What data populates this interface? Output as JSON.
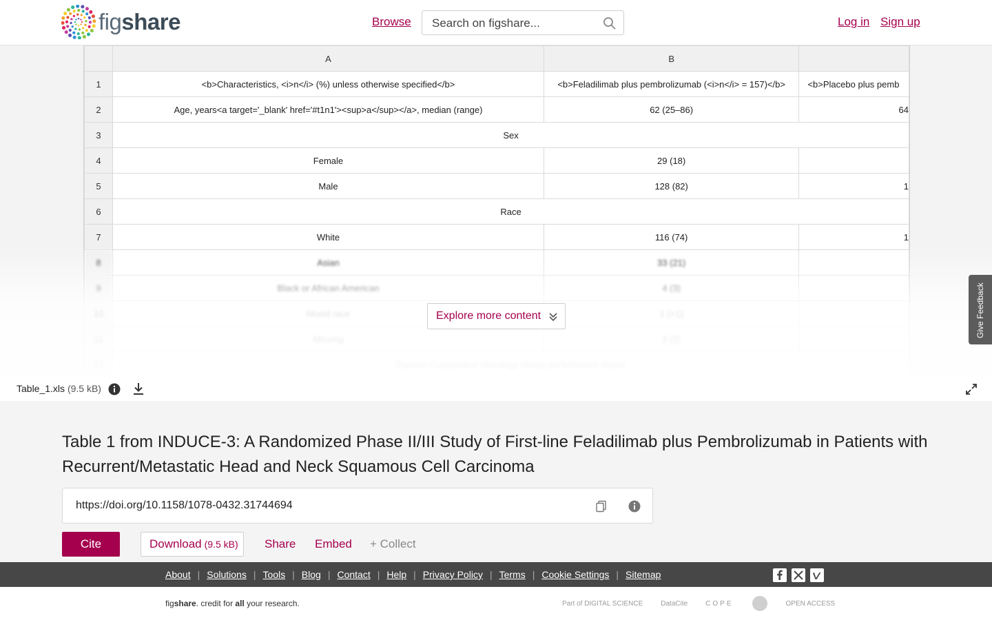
{
  "header": {
    "logo_text_light": "fig",
    "logo_text_bold": "share",
    "browse": "Browse",
    "search_placeholder": "Search on figshare...",
    "login": "Log in",
    "signup": "Sign up"
  },
  "sheet": {
    "columns": [
      "A",
      "B",
      ""
    ],
    "rows": [
      {
        "n": "1",
        "a": "<b>Characteristics, <i>n</i> (%) unless otherwise specified</b>",
        "b": "<b>Feladilimab plus pembrolizumab (<i>n</i> = 157)</b>",
        "c": "<b>Placebo plus pemb"
      },
      {
        "n": "2",
        "a": "Age, years<a target='_blank' href='#t1n1'><sup>a</sup></a>, median (range)",
        "b": "62 (25–86)",
        "c": "64"
      },
      {
        "n": "3",
        "merged": "Sex"
      },
      {
        "n": "4",
        "a": "Female",
        "b": "29 (18)",
        "c": ""
      },
      {
        "n": "5",
        "a": "Male",
        "b": "128 (82)",
        "c": "1"
      },
      {
        "n": "6",
        "merged": "Race"
      },
      {
        "n": "7",
        "a": "White",
        "b": "116 (74)",
        "c": "1"
      },
      {
        "n": "8",
        "a": "Asian",
        "b": "33 (21)",
        "c": ""
      },
      {
        "n": "9",
        "a": "Black or African American",
        "b": "4 (3)",
        "c": ""
      },
      {
        "n": "10",
        "a": "Mixed race",
        "b": "1 (<1)",
        "c": ""
      },
      {
        "n": "11",
        "a": "Missing",
        "b": "3 (2)",
        "c": ""
      },
      {
        "n": "12",
        "merged": "Eastern Cooperative Oncology Group performance status"
      }
    ],
    "explore_label": "Explore more content"
  },
  "feedback": "Give Feedback",
  "file": {
    "name": "Table_1.xls",
    "size": "(9.5 kB)"
  },
  "item": {
    "title": "Table 1 from INDUCE-3: A Randomized Phase II/III Study of First-line Feladilimab plus Pembrolizumab in Patients with Recurrent/Metastatic Head and Neck Squamous Cell Carcinoma",
    "doi": "https://doi.org/10.1158/1078-0432.31744694",
    "cite": "Cite",
    "download": "Download",
    "download_size": "(9.5 kB)",
    "share": "Share",
    "embed": "Embed",
    "collect": "+ Collect"
  },
  "footer": {
    "links": [
      "About",
      "Solutions",
      "Tools",
      "Blog",
      "Contact",
      "Help",
      "Privacy Policy",
      "Terms",
      "Cookie Settings",
      "Sitemap"
    ],
    "tagline_fig": "fig",
    "tagline_share": "share",
    "tagline_mid": ". credit for ",
    "tagline_all": "all",
    "tagline_end": " your research.",
    "partners": [
      "Part of DIGITAL SCIENCE",
      "DataCite",
      "COPE",
      "",
      "OPEN ACCESS"
    ]
  },
  "colors": {
    "brand": "#a5004d",
    "footer_bg": "#474747"
  }
}
